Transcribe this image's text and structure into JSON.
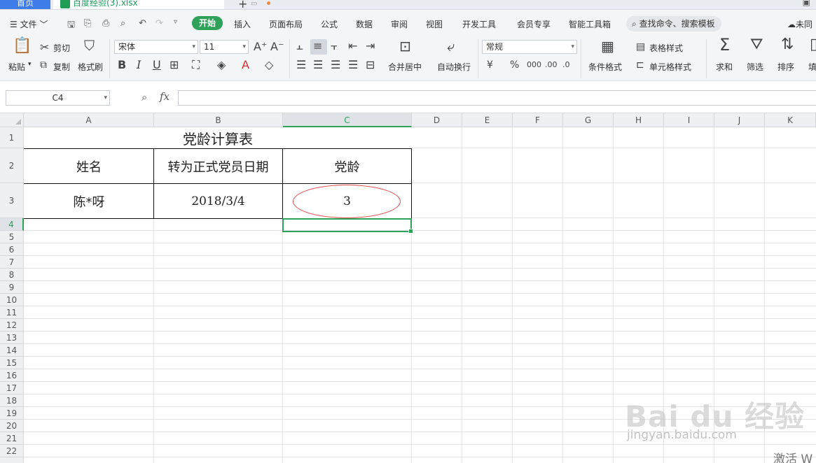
{
  "tabs": {
    "home": "首页",
    "file": "百度经验(3).xlsx",
    "add": "+"
  },
  "menu": {
    "file": "文件",
    "items": [
      "开始",
      "插入",
      "页面布局",
      "公式",
      "数据",
      "审阅",
      "视图",
      "开发工具",
      "会员专享",
      "智能工具箱"
    ],
    "search": "查找命令、搜索模板",
    "right": "未同"
  },
  "ribbon": {
    "paste": "粘贴",
    "cut": "剪切",
    "copy": "复制",
    "format_painter": "格式刷",
    "font_name": "宋体",
    "font_size": "11",
    "merge_center": "合并居中",
    "wrap_text": "自动换行",
    "number_format": "常规",
    "conditional_format": "条件格式",
    "table_style": "表格样式",
    "cell_style": "单元格样式",
    "sum": "求和",
    "filter": "筛选",
    "sort": "排序",
    "fill": "填"
  },
  "formula_bar": {
    "name_box": "C4",
    "fx": "fx",
    "value": ""
  },
  "columns": [
    "A",
    "B",
    "C",
    "D",
    "E",
    "F",
    "G",
    "H",
    "I",
    "J",
    "K"
  ],
  "rows": [
    "1",
    "2",
    "3",
    "4",
    "5",
    "6",
    "7",
    "8",
    "9",
    "10",
    "11",
    "12",
    "13",
    "14",
    "15",
    "16",
    "17",
    "18",
    "19",
    "20",
    "21",
    "22"
  ],
  "sheet": {
    "title": "党龄计算表",
    "headers": {
      "name": "姓名",
      "date": "转为正式党员日期",
      "age": "党龄"
    },
    "row": {
      "name": "陈*呀",
      "date": "2018/3/4",
      "age": "3"
    }
  },
  "selected_cell": "C4",
  "watermark": {
    "main": "Bai du 经验",
    "sub": "jingyan.baidu.com"
  },
  "activate_text": "激活 W",
  "colors": {
    "accent": "#2ea259",
    "tab_blue": "#3f7ee8",
    "annotation": "#e04848"
  }
}
